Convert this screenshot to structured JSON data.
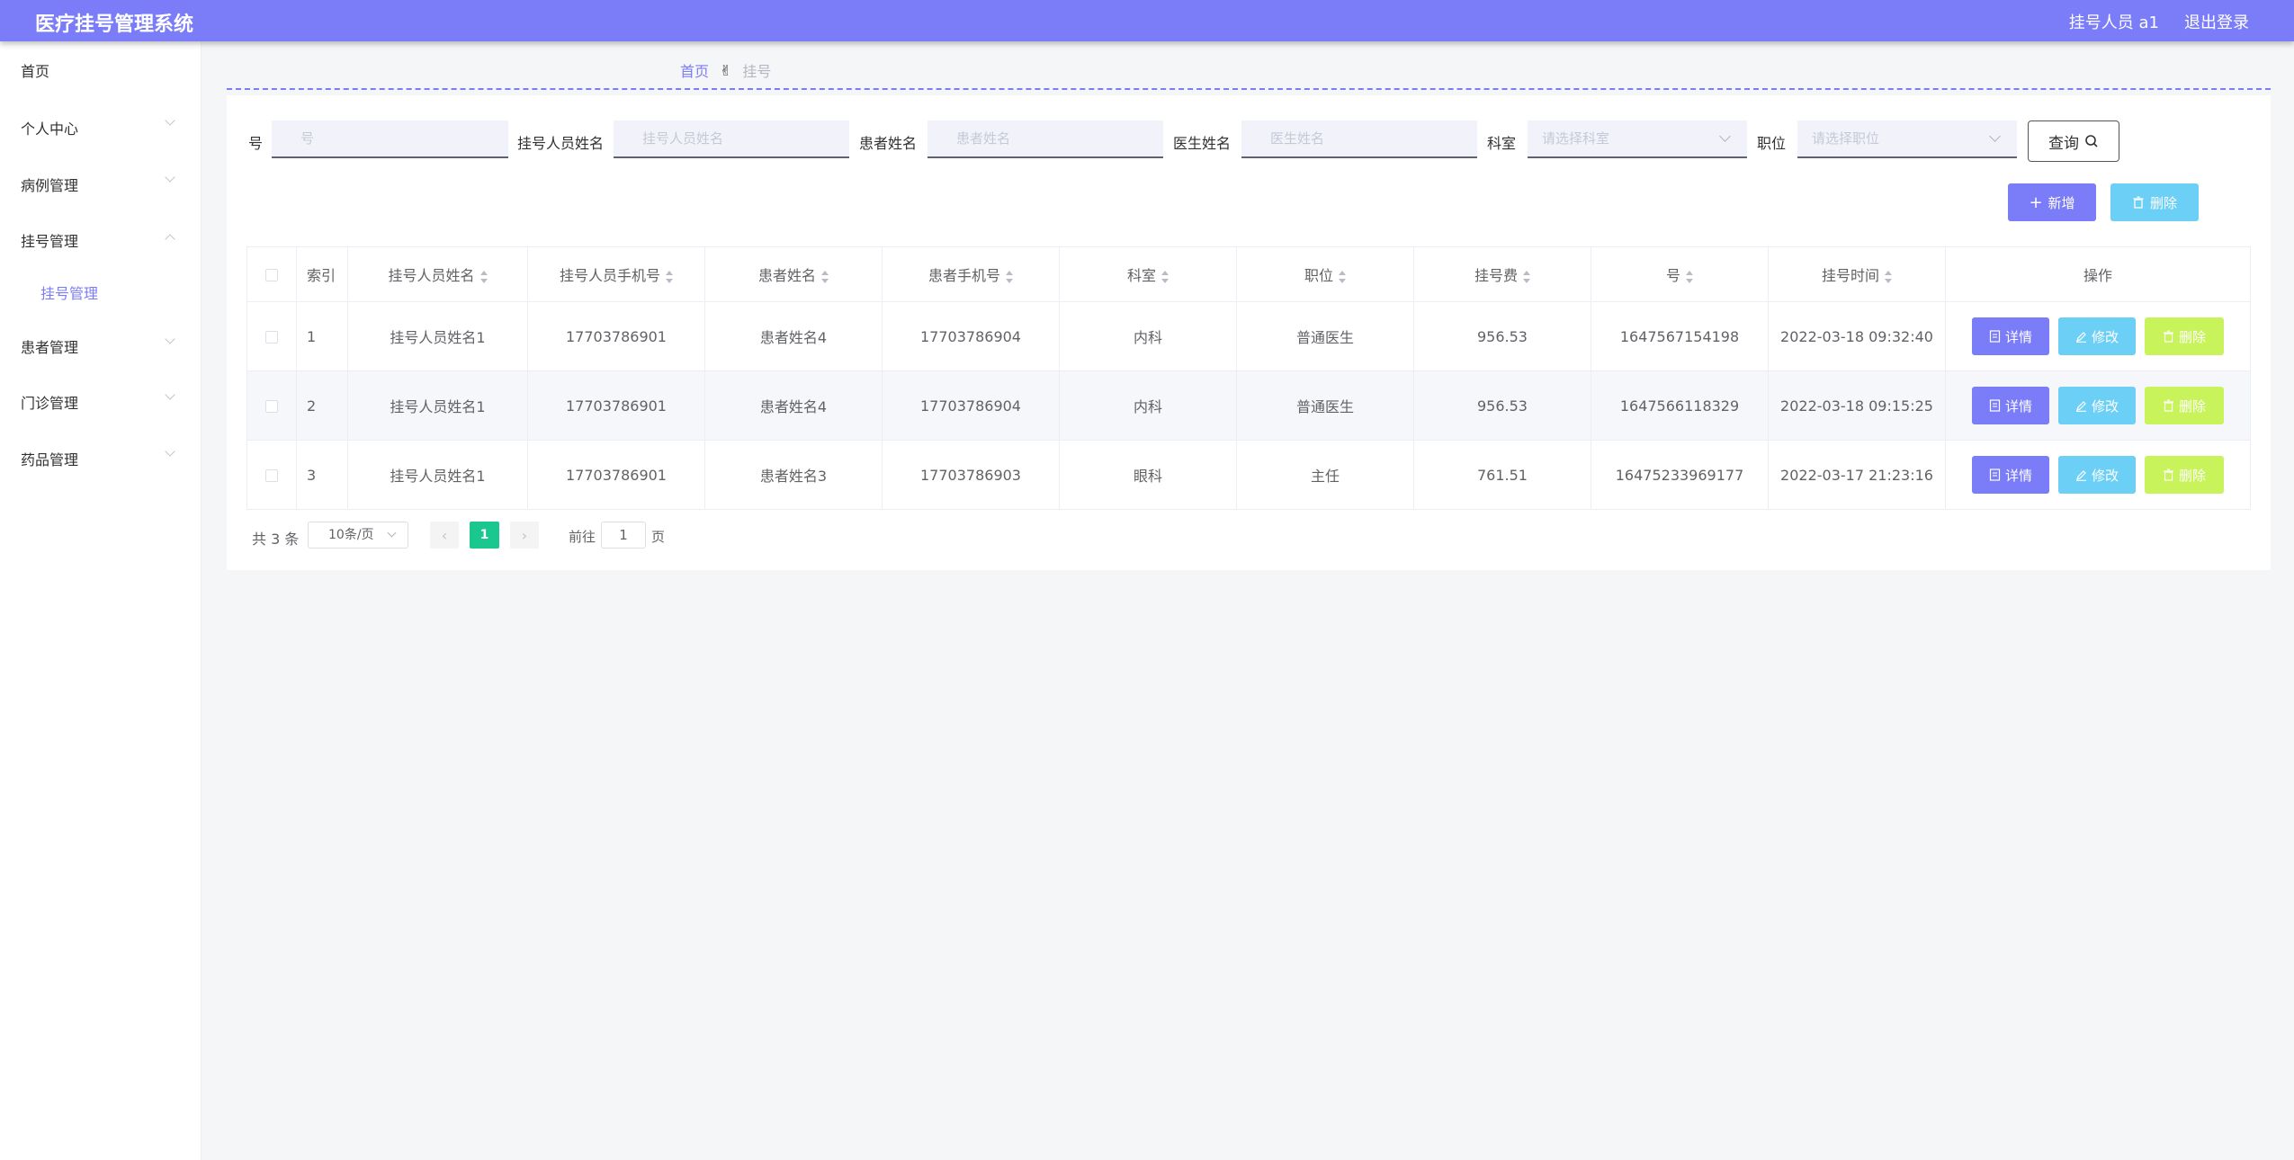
{
  "header": {
    "title": "医疗挂号管理系统",
    "user": "挂号人员 a1",
    "logout": "退出登录"
  },
  "sidebar": {
    "items": [
      {
        "label": "首页"
      },
      {
        "label": "个人中心"
      },
      {
        "label": "病例管理"
      },
      {
        "label": "挂号管理"
      },
      {
        "label": "挂号管理"
      },
      {
        "label": "患者管理"
      },
      {
        "label": "门诊管理"
      },
      {
        "label": "药品管理"
      }
    ]
  },
  "breadcrumb": {
    "home": "首页",
    "current": "挂号"
  },
  "filters": {
    "hao": {
      "label": "号",
      "placeholder": "号"
    },
    "staff_name": {
      "label": "挂号人员姓名",
      "placeholder": "挂号人员姓名"
    },
    "patient_name": {
      "label": "患者姓名",
      "placeholder": "患者姓名"
    },
    "doctor_name": {
      "label": "医生姓名",
      "placeholder": "医生姓名"
    },
    "department": {
      "label": "科室",
      "placeholder": "请选择科室"
    },
    "position": {
      "label": "职位",
      "placeholder": "请选择职位"
    },
    "search": "查询"
  },
  "actions": {
    "add": "新增",
    "delete": "删除"
  },
  "table": {
    "headers": [
      "索引",
      "挂号人员姓名",
      "挂号人员手机号",
      "患者姓名",
      "患者手机号",
      "科室",
      "职位",
      "挂号费",
      "号",
      "挂号时间",
      "操作"
    ],
    "rows": [
      {
        "index": "1",
        "staff_name": "挂号人员姓名1",
        "staff_phone": "17703786901",
        "patient_name": "患者姓名4",
        "patient_phone": "17703786904",
        "department": "内科",
        "position": "普通医生",
        "fee": "956.53",
        "hao": "1647567154198",
        "time": "2022-03-18 09:32:40"
      },
      {
        "index": "2",
        "staff_name": "挂号人员姓名1",
        "staff_phone": "17703786901",
        "patient_name": "患者姓名4",
        "patient_phone": "17703786904",
        "department": "内科",
        "position": "普通医生",
        "fee": "956.53",
        "hao": "1647566118329",
        "time": "2022-03-18 09:15:25"
      },
      {
        "index": "3",
        "staff_name": "挂号人员姓名1",
        "staff_phone": "17703786901",
        "patient_name": "患者姓名3",
        "patient_phone": "17703786903",
        "department": "眼科",
        "position": "主任",
        "fee": "761.51",
        "hao": "16475233969177",
        "time": "2022-03-17 21:23:16"
      }
    ],
    "row_actions": {
      "detail": "详情",
      "edit": "修改",
      "delete": "删除"
    }
  },
  "pagination": {
    "total": "共 3 条",
    "page_size": "10条/页",
    "current_page": "1",
    "goto_prefix": "前往",
    "goto_value": "1",
    "goto_suffix": "页"
  },
  "colors": {
    "primary": "#7b7cf7",
    "info": "#6ccff6",
    "lime": "#c9f35a",
    "page_active": "#19c78f"
  }
}
